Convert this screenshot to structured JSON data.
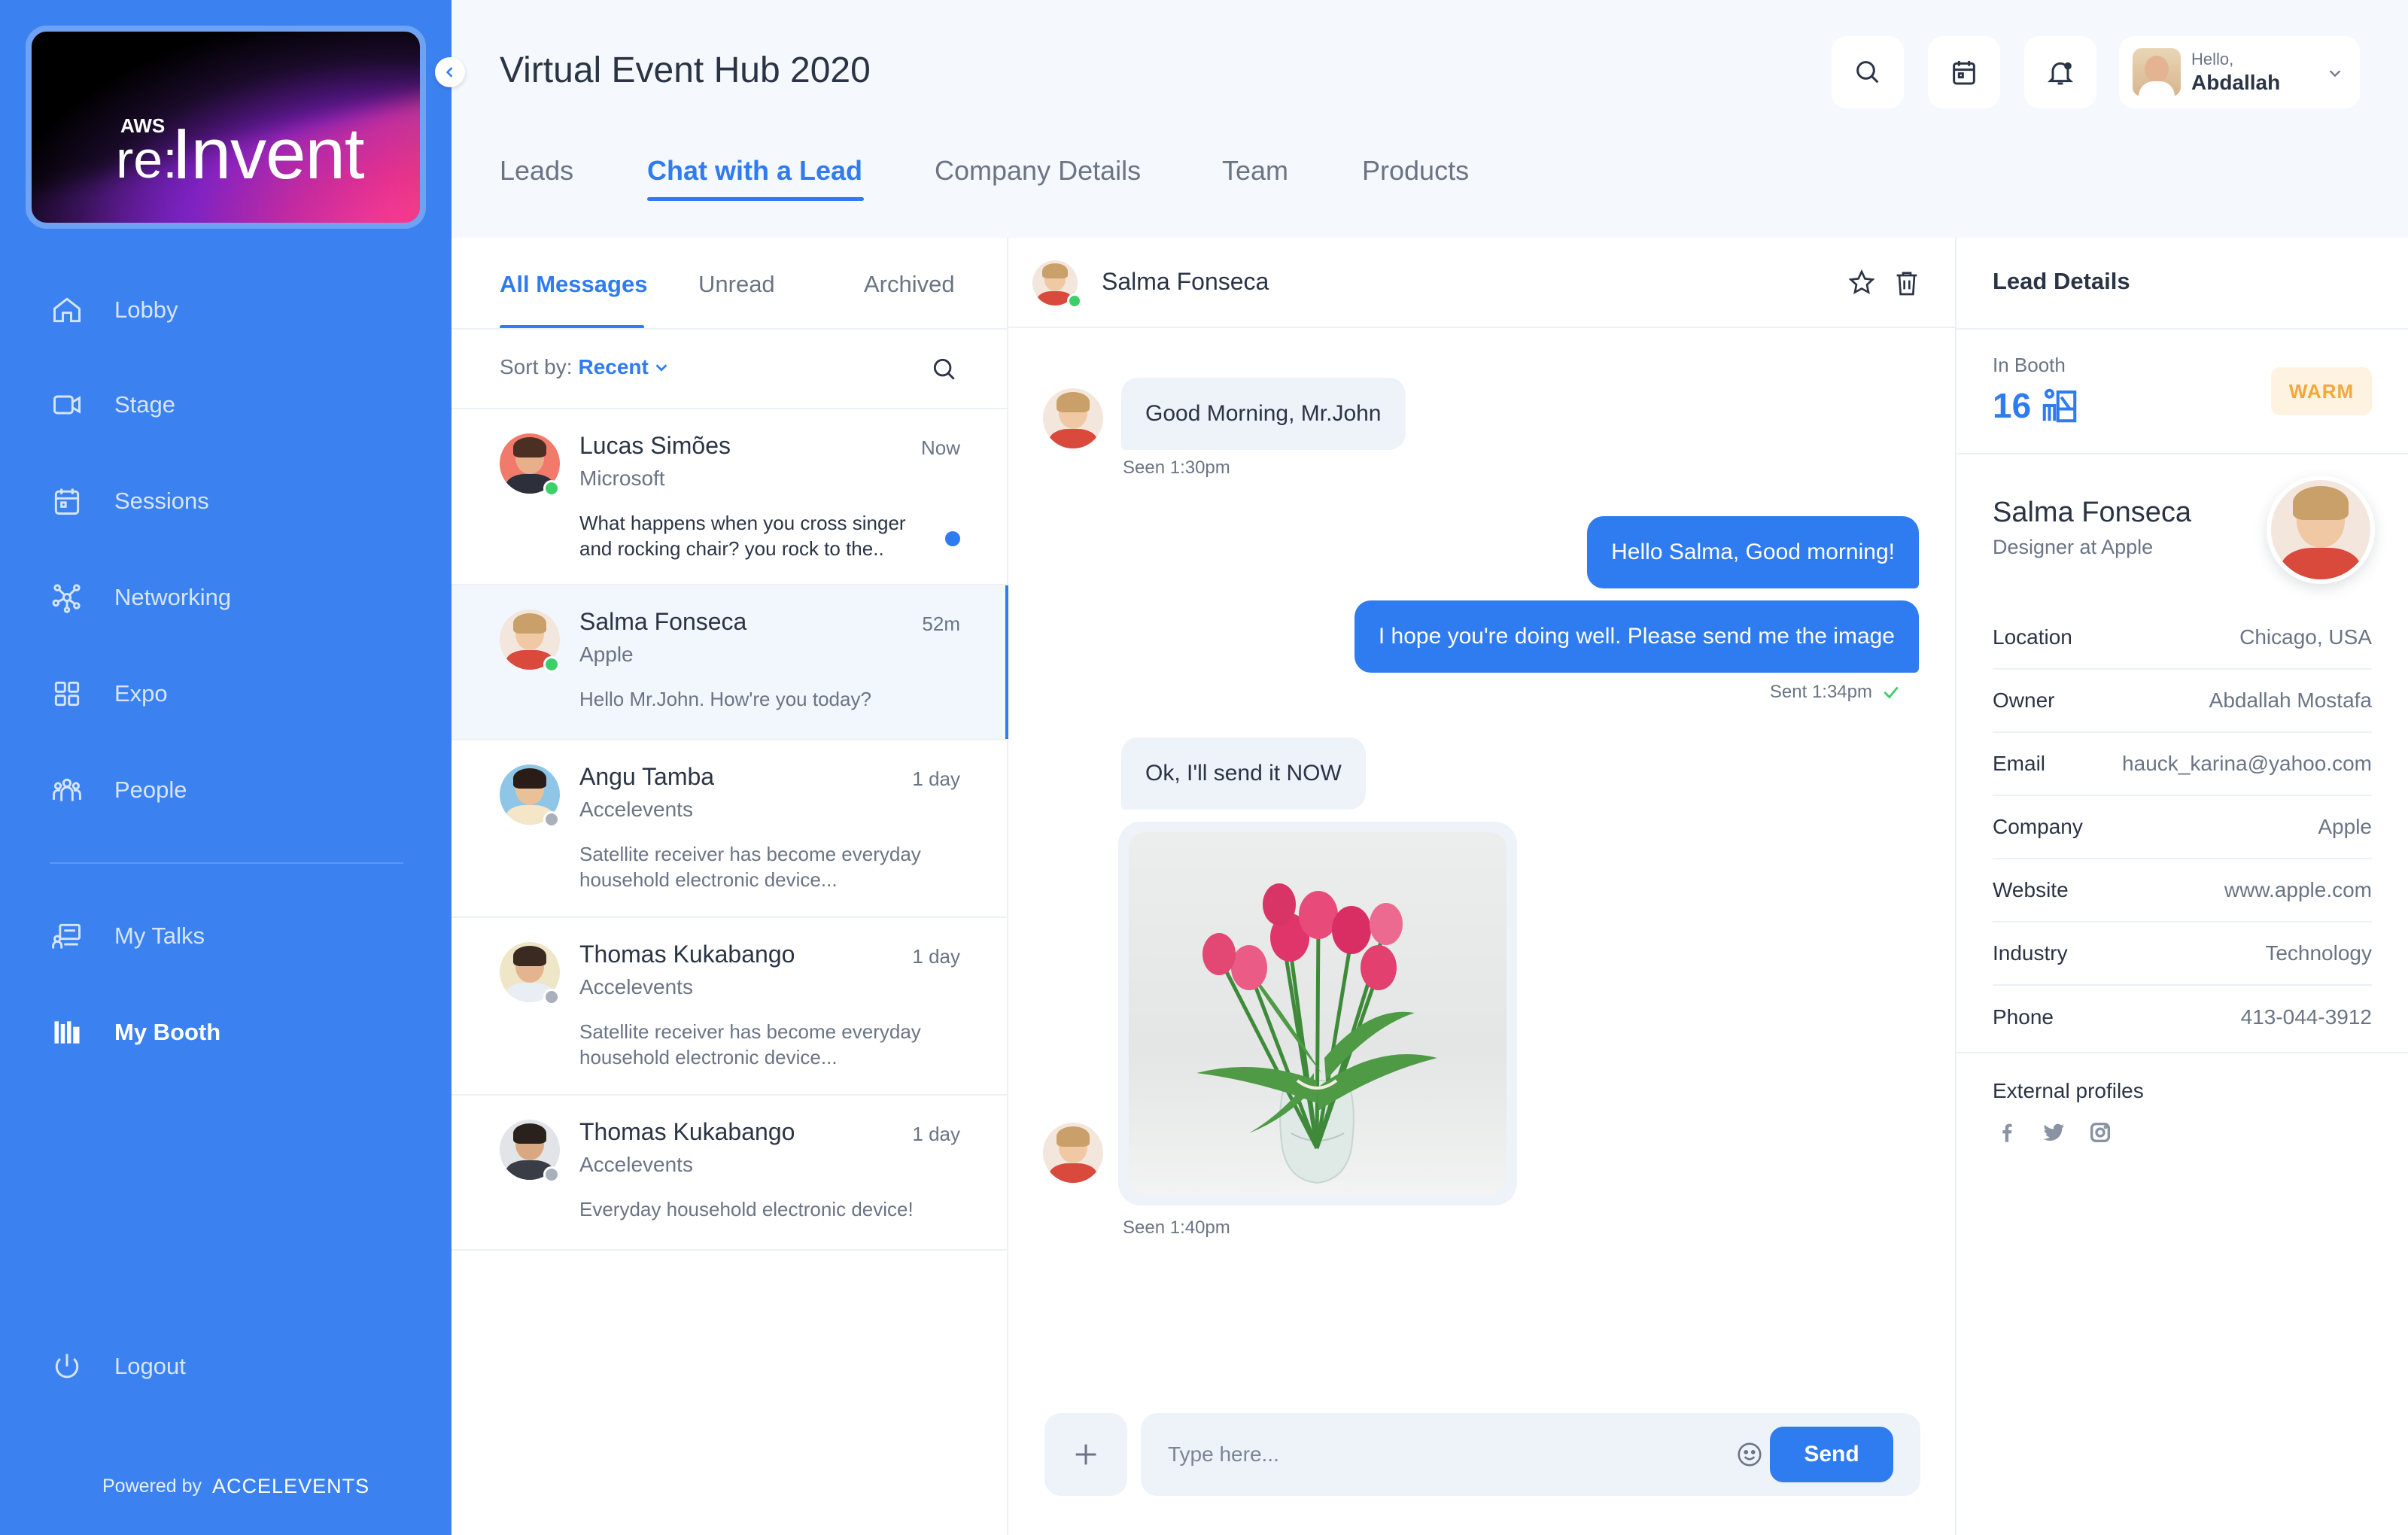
{
  "sidebar": {
    "logo": {
      "aws": "AWS",
      "re": "re:",
      "invent": "Invent"
    },
    "items": [
      {
        "label": "Lobby"
      },
      {
        "label": "Stage"
      },
      {
        "label": "Sessions"
      },
      {
        "label": "Networking"
      },
      {
        "label": "Expo"
      },
      {
        "label": "People"
      },
      {
        "label": "My Talks"
      },
      {
        "label": "My Booth",
        "active": true
      },
      {
        "label": "Logout"
      }
    ],
    "powered_by": "Powered by",
    "brand": "ACCELEVENTS"
  },
  "header": {
    "title": "Virtual Event Hub 2020",
    "user": {
      "greeting": "Hello,",
      "name": "Abdallah"
    },
    "icons": [
      "search-icon",
      "calendar-icon",
      "bell-icon"
    ]
  },
  "tabs": [
    {
      "label": "Leads"
    },
    {
      "label": "Chat with a Lead",
      "active": true
    },
    {
      "label": "Company Details"
    },
    {
      "label": "Team"
    },
    {
      "label": "Products"
    }
  ],
  "messages": {
    "tabs": [
      {
        "label": "All Messages",
        "active": true
      },
      {
        "label": "Unread"
      },
      {
        "label": "Archived"
      }
    ],
    "sort": {
      "label": "Sort by:",
      "value": "Recent"
    },
    "conversations": [
      {
        "name": "Lucas Simões",
        "company": "Microsoft",
        "time": "Now",
        "preview": "What happens when you cross singer and rocking chair? you rock to the..",
        "status": "online",
        "unread": true
      },
      {
        "name": "Salma Fonseca",
        "company": "Apple",
        "time": "52m",
        "preview": "Hello Mr.John. How're you today?",
        "status": "online",
        "active": true
      },
      {
        "name": "Angu Tamba",
        "company": "Accelevents",
        "time": "1 day",
        "preview": "Satellite receiver has become everyday household electronic device...",
        "status": "offline"
      },
      {
        "name": "Thomas Kukabango",
        "company": "Accelevents",
        "time": "1 day",
        "preview": "Satellite receiver has become everyday household electronic device...",
        "status": "offline"
      },
      {
        "name": "Thomas Kukabango",
        "company": "Accelevents",
        "time": "1 day",
        "preview": "Everyday household electronic device!",
        "status": "offline"
      }
    ]
  },
  "chat": {
    "contact": "Salma Fonseca",
    "messages": [
      {
        "dir": "in",
        "text": "Good Morning, Mr.John",
        "meta": "Seen 1:30pm"
      },
      {
        "dir": "out",
        "text": "Hello Salma, Good morning!"
      },
      {
        "dir": "out",
        "text": "I hope you're doing well. Please send me the image",
        "meta": "Sent 1:34pm"
      },
      {
        "dir": "in",
        "text": "Ok, I'll send it NOW"
      },
      {
        "dir": "in",
        "type": "image",
        "subject": "pink tulips in a glass vase",
        "meta": "Seen 1:40pm"
      }
    ],
    "composer": {
      "placeholder": "Type here...",
      "send_label": "Send"
    }
  },
  "lead": {
    "title": "Lead Details",
    "booth_label": "In Booth",
    "booth_number": "16",
    "temperature": "WARM",
    "name": "Salma Fonseca",
    "role": "Designer at Apple",
    "fields": [
      {
        "key": "Location",
        "value": "Chicago, USA"
      },
      {
        "key": "Owner",
        "value": "Abdallah Mostafa"
      },
      {
        "key": "Email",
        "value": "hauck_karina@yahoo.com"
      },
      {
        "key": "Company",
        "value": "Apple"
      },
      {
        "key": "Website",
        "value": "www.apple.com"
      },
      {
        "key": "Industry",
        "value": "Technology"
      },
      {
        "key": "Phone",
        "value": "413-044-3912"
      }
    ],
    "external_title": "External profiles",
    "socials": [
      "facebook-icon",
      "twitter-icon",
      "instagram-icon"
    ]
  },
  "colors": {
    "accent": "#2f7bf0",
    "sidebar": "#3b82f0",
    "online": "#3ccf6a",
    "offline": "#a9b0bc",
    "warm": "#f4a73b"
  }
}
